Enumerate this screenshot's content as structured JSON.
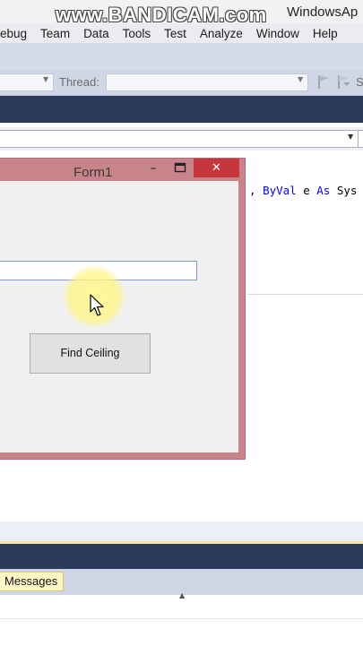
{
  "watermark": "www.BANDICAM.com",
  "window_title": "WindowsAp",
  "menu": [
    "ebug",
    "Team",
    "Data",
    "Tools",
    "Test",
    "Analyze",
    "Window",
    "Help"
  ],
  "toolbar": {
    "thread_label": "Thread:",
    "trailing_text": "S"
  },
  "code": {
    "t1": ", ",
    "kw1": "ByVal",
    "t2": " e ",
    "kw2": "As",
    "t3": " Sys"
  },
  "form1": {
    "title": "Form1",
    "minimize_glyph": "–",
    "close_glyph": "✕",
    "input_value": "",
    "button_label": "Find Ceiling"
  },
  "bottom": {
    "tab_label": "Messages"
  },
  "colors": {
    "form_frame": "#c9838b",
    "close_button": "#c7363d",
    "navy_band": "#2b3a5b",
    "tab_highlight": "#fff6c8",
    "cursor_highlight": "#fff39a"
  }
}
